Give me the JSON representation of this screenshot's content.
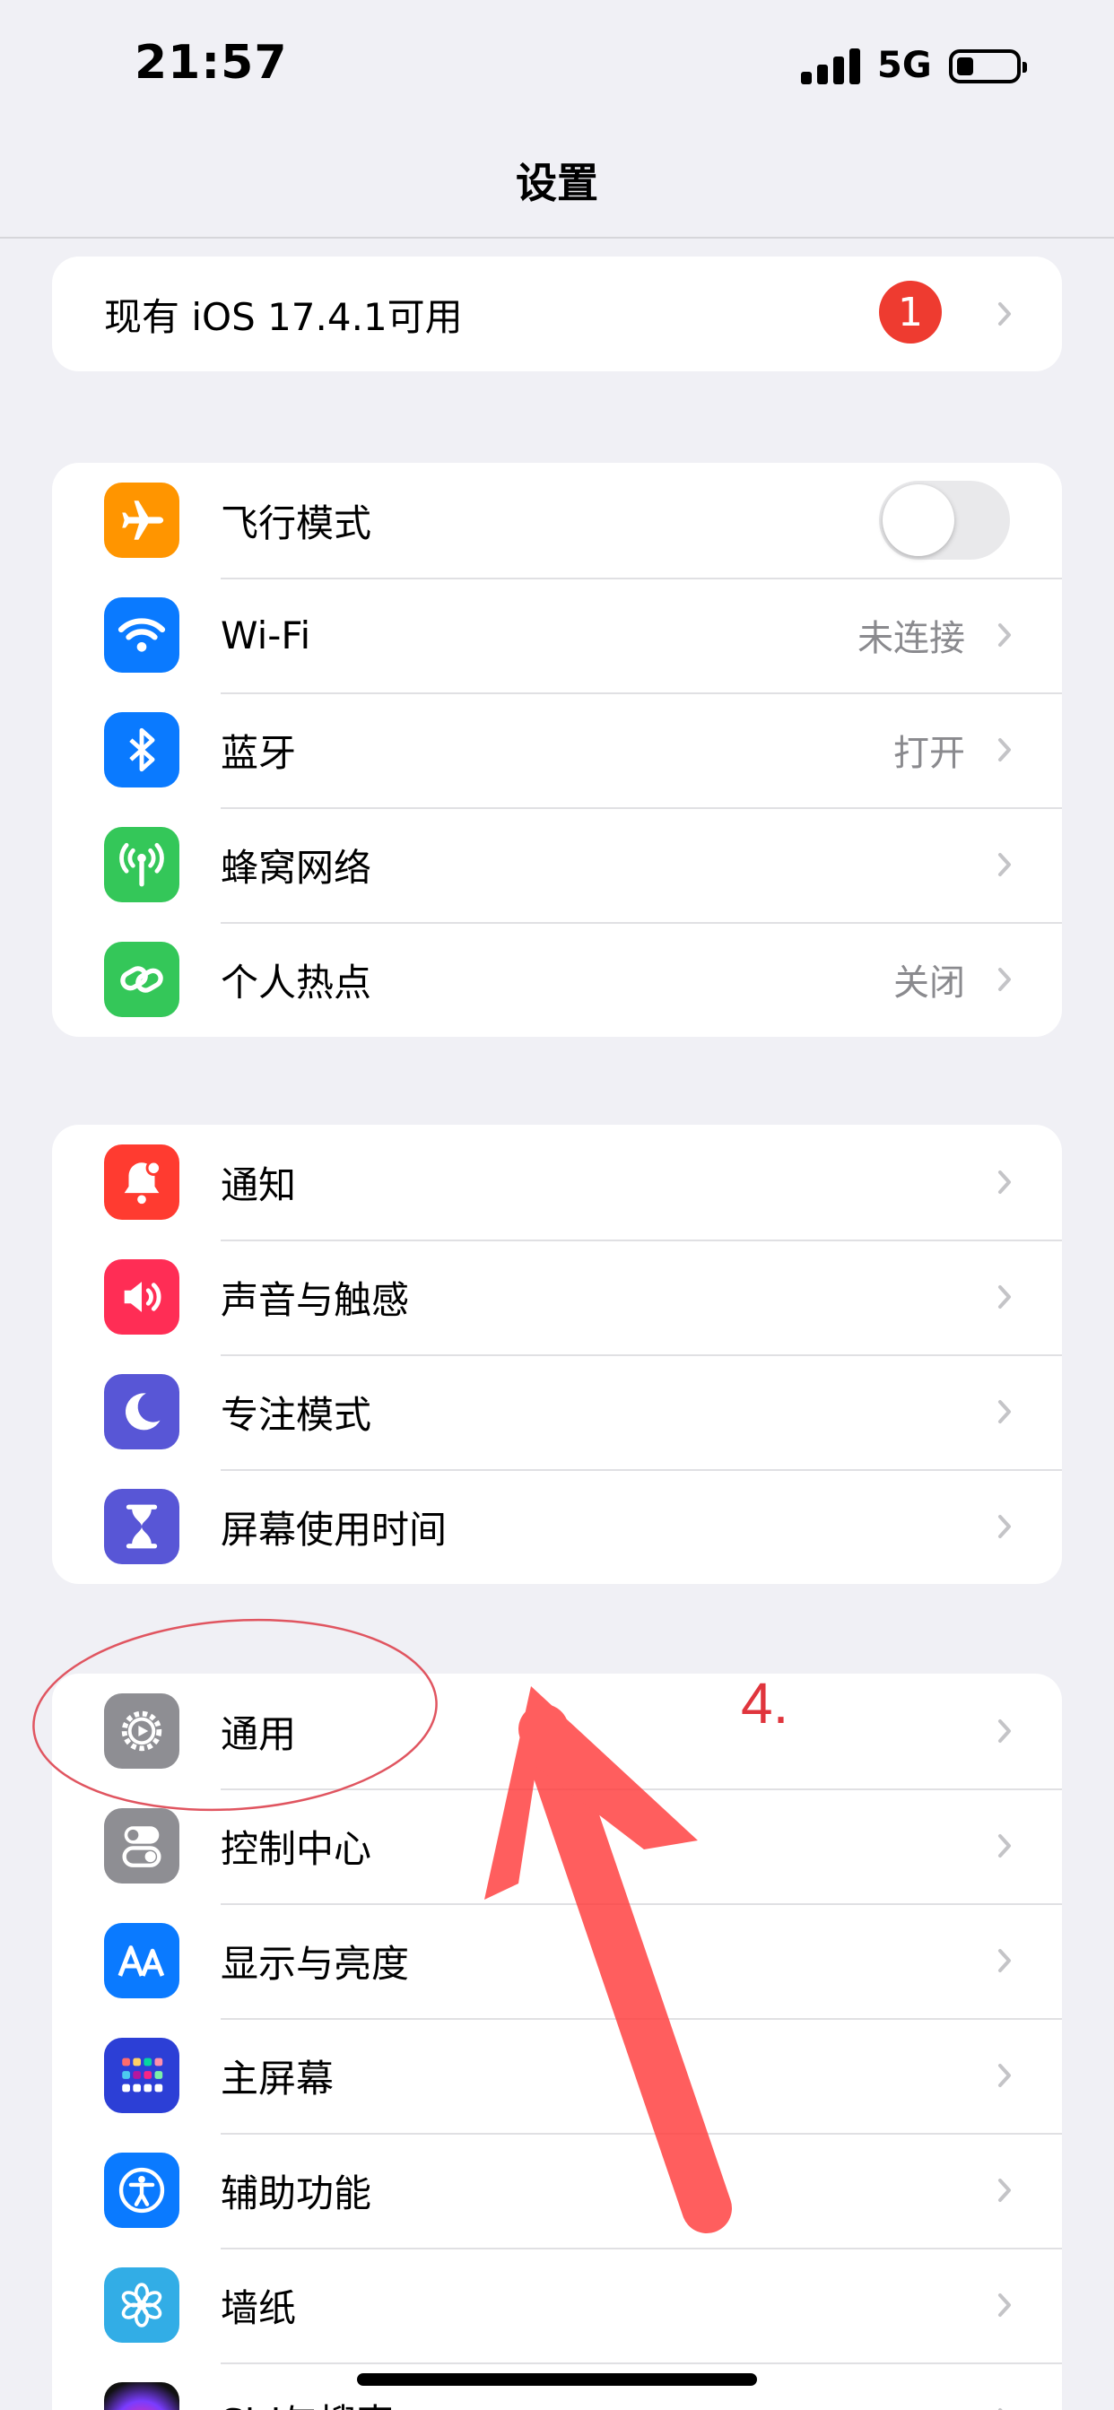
{
  "status_bar": {
    "time": "21:57",
    "network": "5G"
  },
  "nav": {
    "title": "设置"
  },
  "update": {
    "label": "现有 iOS 17.4.1可用",
    "badge": "1"
  },
  "group1": {
    "airplane": {
      "label": "飞行模式",
      "toggle_on": false
    },
    "wifi": {
      "label": "Wi-Fi",
      "value": "未连接"
    },
    "bluetooth": {
      "label": "蓝牙",
      "value": "打开"
    },
    "cellular": {
      "label": "蜂窝网络"
    },
    "hotspot": {
      "label": "个人热点",
      "value": "关闭"
    }
  },
  "group2": {
    "notifications": {
      "label": "通知"
    },
    "sounds": {
      "label": "声音与触感"
    },
    "focus": {
      "label": "专注模式"
    },
    "screen_time": {
      "label": "屏幕使用时间"
    }
  },
  "group3": {
    "general": {
      "label": "通用"
    },
    "control_center": {
      "label": "控制中心"
    },
    "display": {
      "label": "显示与亮度"
    },
    "home_screen": {
      "label": "主屏幕"
    },
    "accessibility": {
      "label": "辅助功能"
    },
    "wallpaper": {
      "label": "墙纸"
    },
    "siri": {
      "label": "Siri与搜索"
    }
  },
  "annotation": {
    "step": "4."
  },
  "colors": {
    "airplane": "#ff9500",
    "wifi": "#0a7aff",
    "bluetooth": "#0a7aff",
    "cellular": "#34c759",
    "hotspot": "#34c759",
    "notifications": "#ff3b30",
    "sounds": "#ff2d55",
    "focus": "#5856d6",
    "screen_time": "#5856d6",
    "general": "#8e8e93",
    "control_center": "#8e8e93",
    "display": "#0a7aff",
    "home_screen": "#2c3fd6",
    "accessibility": "#0a7aff",
    "wallpaper": "#32ade6",
    "annotation": "#e0353d"
  }
}
